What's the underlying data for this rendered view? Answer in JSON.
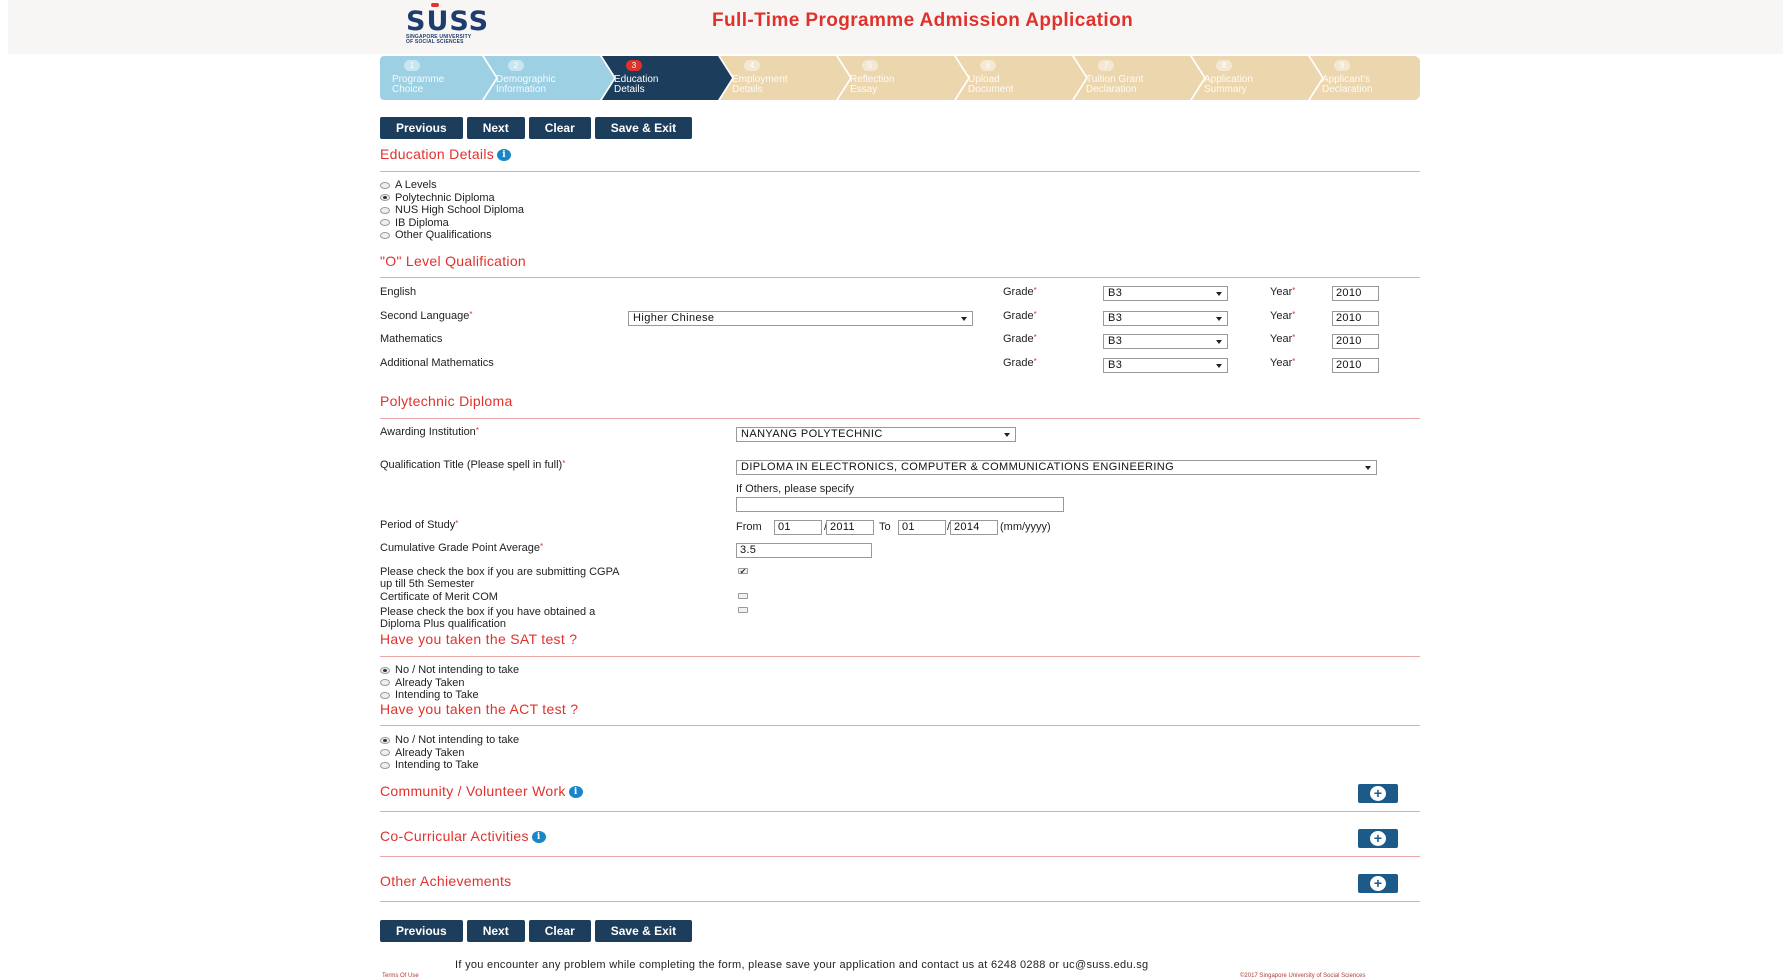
{
  "header": {
    "logo_text": "SUSS",
    "logo_sub1": "SINGAPORE UNIVERSITY",
    "logo_sub2": "OF SOCIAL SCIENCES",
    "title": "Full-Time Programme Admission Application"
  },
  "steps": [
    {
      "num": "1",
      "label": "Programme\nChoice",
      "state": "done"
    },
    {
      "num": "2",
      "label": "Demographic\nInformation",
      "state": "done"
    },
    {
      "num": "3",
      "label": "Education\nDetails",
      "state": "active"
    },
    {
      "num": "4",
      "label": "Employment\nDetails",
      "state": "todo"
    },
    {
      "num": "5",
      "label": "Reflection\nEssay",
      "state": "todo"
    },
    {
      "num": "6",
      "label": "Upload\nDocument",
      "state": "todo"
    },
    {
      "num": "7",
      "label": "Tuition Grant\nDeclaration",
      "state": "todo"
    },
    {
      "num": "8",
      "label": "Application\nSummary",
      "state": "todo"
    },
    {
      "num": "9",
      "label": "Applicant's\nDeclaration",
      "state": "todo"
    }
  ],
  "buttons": {
    "previous": "Previous",
    "next": "Next",
    "clear": "Clear",
    "save_exit": "Save & Exit"
  },
  "education": {
    "heading": "Education Details",
    "options": [
      "A Levels",
      "Polytechnic Diploma",
      "NUS High School Diploma",
      "IB Diploma",
      "Other Qualifications"
    ],
    "selected_index": 1
  },
  "o_level": {
    "heading": "\"O\" Level Qualification",
    "grade_label": "Grade",
    "year_label": "Year",
    "rows": [
      {
        "subject": "English",
        "required": false,
        "language": "",
        "grade": "B3",
        "year": "2010"
      },
      {
        "subject": "Second Language",
        "required": true,
        "language": "Higher Chinese",
        "grade": "B3",
        "year": "2010"
      },
      {
        "subject": "Mathematics",
        "required": false,
        "language": "",
        "grade": "B3",
        "year": "2010"
      },
      {
        "subject": "Additional Mathematics",
        "required": false,
        "language": "",
        "grade": "B3",
        "year": "2010"
      }
    ]
  },
  "poly": {
    "heading": "Polytechnic Diploma",
    "institution_label": "Awarding Institution",
    "institution_value": "NANYANG POLYTECHNIC",
    "qual_label": "Qualification Title (Please spell in full)",
    "qual_value": "DIPLOMA IN ELECTRONICS, COMPUTER & COMMUNICATIONS ENGINEERING",
    "others_label": "If Others, please specify",
    "others_value": "",
    "period_label": "Period of Study",
    "from_label": "From",
    "from_month": "01",
    "from_year": "2011",
    "to_label": "To",
    "to_month": "01",
    "to_year": "2014",
    "slash": "/",
    "format_hint": "(mm/yyyy)",
    "cgpa_label": "Cumulative Grade Point Average",
    "cgpa_value": "3.5",
    "cgpa_check_label": "Please check the box if you are submitting CGPA\nup till 5th Semester",
    "cgpa_check_mark": "✔",
    "merit_label": "Certificate of Merit COM",
    "diploma_plus_label": "Please check the box if you have obtained a\nDiploma Plus qualification"
  },
  "sat": {
    "heading": "Have you taken the SAT test ?",
    "options": [
      "No / Not intending to take",
      "Already Taken",
      "Intending to Take"
    ],
    "selected_index": 0
  },
  "act": {
    "heading": "Have you taken the ACT test ?",
    "options": [
      "No / Not intending to take",
      "Already Taken",
      "Intending to Take"
    ],
    "selected_index": 0
  },
  "sections": {
    "community": "Community / Volunteer Work",
    "cca": "Co-Curricular Activities",
    "other": "Other Achievements",
    "add_glyph": "+"
  },
  "footer": {
    "note": "If you encounter any problem while completing the form, please save your application and contact us at 6248 0288 or uc@suss.edu.sg",
    "terms": "Terms Of Use",
    "copyright": "©2017 Singapore University of Social Sciences"
  },
  "icons": {
    "info": "i"
  },
  "colors": {
    "navy": "#1c3d5c",
    "accent_red": "#e0322d",
    "step_done": "#9dd0e3",
    "step_todo": "#ecd6ae"
  }
}
